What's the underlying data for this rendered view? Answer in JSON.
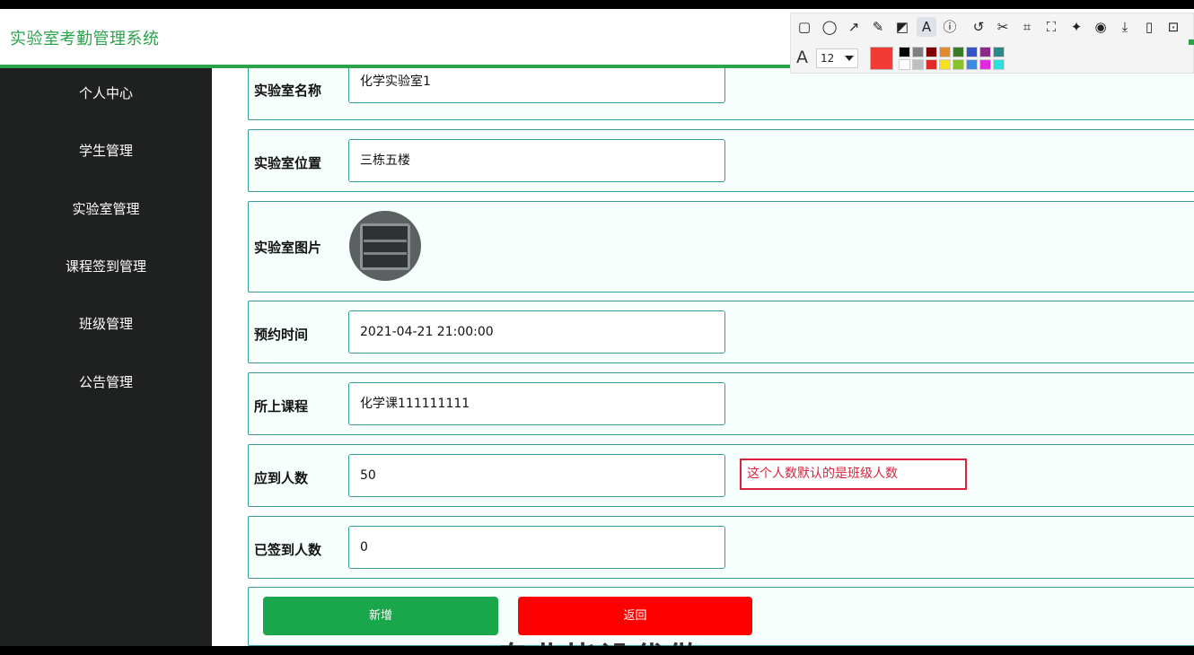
{
  "app": {
    "title": "实验室考勤管理系统"
  },
  "sidebar": {
    "items": [
      {
        "label": "个人中心"
      },
      {
        "label": "学生管理"
      },
      {
        "label": "实验室管理"
      },
      {
        "label": "课程签到管理"
      },
      {
        "label": "班级管理"
      },
      {
        "label": "公告管理"
      }
    ]
  },
  "form": {
    "fields": [
      {
        "label": "实验室名称",
        "value": "化学实验室1"
      },
      {
        "label": "实验室位置",
        "value": "三栋五楼"
      },
      {
        "label": "实验室图片",
        "image": "lab-photo"
      },
      {
        "label": "预约时间",
        "value": "2021-04-21 21:00:00"
      },
      {
        "label": "所上课程",
        "value": "化学课111111111"
      },
      {
        "label": "应到人数",
        "value": "50"
      },
      {
        "label": "已签到人数",
        "value": "0"
      }
    ],
    "annotation": "这个人数默认的是班级人数",
    "buttons": {
      "add": {
        "label": "新增",
        "color": "#1aa64a"
      },
      "back": {
        "label": "返回",
        "color": "#ff0000"
      }
    }
  },
  "overlay_text": "专业毕设代做",
  "annotation_toolbar": {
    "font_size": "12",
    "current_color": "#f23b35",
    "tools": [
      "rectangle-icon",
      "ellipse-icon",
      "arrow-icon",
      "pencil-icon",
      "mosaic-icon",
      "text-icon",
      "number-icon",
      "undo-icon",
      "cut-icon",
      "translate-icon",
      "ocr-icon",
      "pin-icon",
      "record-icon",
      "download-icon",
      "save-icon",
      "bookmark-icon"
    ],
    "palette": [
      "#000000",
      "#808080",
      "#800000",
      "#e38a2a",
      "#3b7a2a",
      "#3355cc",
      "#8a2a8a",
      "#2a8a8a",
      "#ffffff",
      "#c0c0c0",
      "#e02b2b",
      "#f2e21a",
      "#8ac22a",
      "#3a8ae0",
      "#e02ae0",
      "#2ae0e0"
    ]
  }
}
